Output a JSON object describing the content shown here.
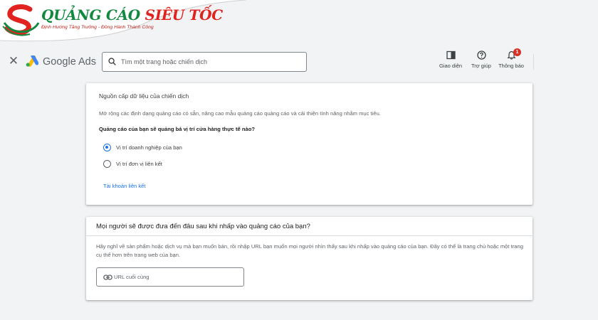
{
  "watermark": {
    "brand_part1": "QUẢNG CÁO",
    "brand_part2": "SIÊU TỐC",
    "slogan": "Định Hướng Tăng Trưởng - Đồng Hành Thành Công"
  },
  "header": {
    "close_icon": "close-icon",
    "product_name": "Google Ads",
    "search_placeholder": "Tìm một trang hoặc chiến dịch",
    "actions": [
      {
        "label": "Giao diện",
        "icon": "appearance-icon"
      },
      {
        "label": "Trợ giúp",
        "icon": "help-icon"
      },
      {
        "label": "Thông báo",
        "icon": "bell-icon",
        "badge": "1"
      }
    ]
  },
  "card1": {
    "title": "Nguồn cấp dữ liệu của chiến dịch",
    "description": "Mở rộng các định dạng quảng cáo có sẵn, nâng cao mẫu quảng cáo quảng cáo và cải thiện tính năng nhằm mục tiêu.",
    "question": "Quảng cáo của bạn sẽ quảng bá vị trí cửa hàng thực tế nào?",
    "options": [
      {
        "label": "Vị trí doanh nghiệp của bạn",
        "selected": true
      },
      {
        "label": "Vị trí đơn vị liên kết",
        "selected": false
      }
    ],
    "link": "Tài khoản liên kết"
  },
  "card2": {
    "title": "Mọi người sẽ được đưa đến đâu sau khi nhấp vào quảng cáo của bạn?",
    "description": "Hãy nghĩ về sản phẩm hoặc dịch vụ mà bạn muốn bán, rồi nhập URL bạn muốn mọi người nhìn thấy sau khi nhấp vào quảng cáo của bạn. Đây có thể là trang chủ hoặc một trang cụ thể hơn trên trang web của bạn.",
    "url_placeholder": "URL cuối cùng",
    "url_icon": "link-icon"
  },
  "colors": {
    "accent": "#1a73e8",
    "background": "#f1f3f4",
    "brand_green": "#13883f",
    "brand_red": "#e0231f"
  }
}
